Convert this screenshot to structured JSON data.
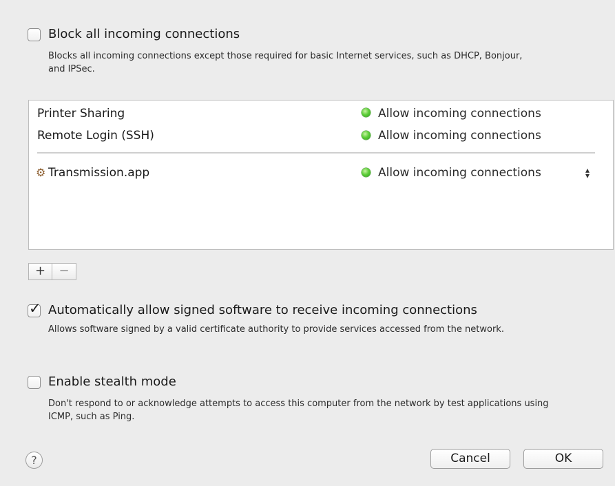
{
  "block_all": {
    "checked": false,
    "label": "Block all incoming connections",
    "description": "Blocks all incoming connections except those required for basic Internet services, such as DHCP, Bonjour, and IPSec."
  },
  "services": [
    {
      "name": "Printer Sharing",
      "status": "Allow incoming connections",
      "status_color": "#4cbb2e"
    },
    {
      "name": "Remote Login (SSH)",
      "status": "Allow incoming connections",
      "status_color": "#4cbb2e"
    }
  ],
  "apps": [
    {
      "name": "Transmission.app",
      "icon": "transmission-app-icon",
      "status": "Allow incoming connections",
      "status_color": "#4cbb2e"
    }
  ],
  "list_controls": {
    "add": "+",
    "remove": "−"
  },
  "auto_allow": {
    "checked": true,
    "label": "Automatically allow signed software to receive incoming connections",
    "description": "Allows software signed by a valid certificate authority to provide services accessed from the network."
  },
  "stealth": {
    "checked": false,
    "label": "Enable stealth mode",
    "description": "Don't respond to or acknowledge attempts to access this computer from the network by test applications using ICMP, such as Ping."
  },
  "footer": {
    "help": "?",
    "cancel": "Cancel",
    "ok": "OK"
  }
}
